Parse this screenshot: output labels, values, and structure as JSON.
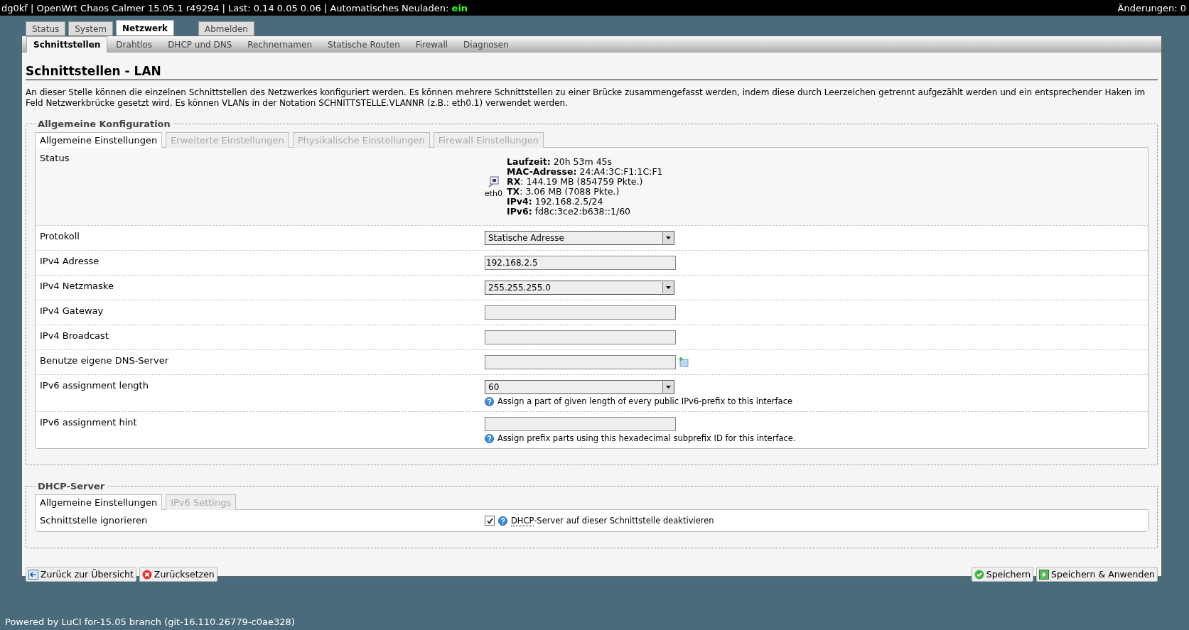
{
  "top_bar": {
    "status_line": "dg0kf | OpenWrt Chaos Calmer 15.05.1 r49294 | Last: 0.14 0.05 0.06 | Automatisches Neuladen:",
    "autoreload": "ein",
    "changes": "Änderungen: 0"
  },
  "main_tabs": [
    {
      "label": "Status",
      "selected": false,
      "kind": "menu"
    },
    {
      "label": "System",
      "selected": false,
      "kind": "menu"
    },
    {
      "label": "Netzwerk",
      "selected": true,
      "kind": "menu"
    },
    {
      "label": "Abmelden",
      "selected": false,
      "kind": "logout"
    }
  ],
  "sub_tabs": [
    {
      "label": "Schnittstellen",
      "selected": true
    },
    {
      "label": "Drahtlos",
      "selected": false
    },
    {
      "label": "DHCP und DNS",
      "selected": false
    },
    {
      "label": "Rechnernamen",
      "selected": false
    },
    {
      "label": "Statische Routen",
      "selected": false
    },
    {
      "label": "Firewall",
      "selected": false
    },
    {
      "label": "Diagnosen",
      "selected": false
    }
  ],
  "title": "Schnittstellen - LAN",
  "description": "An dieser Stelle können die einzelnen Schnittstellen des Netzwerkes konfiguriert werden. Es können mehrere Schnittstellen zu einer Brücke zusammengefasst werden, indem diese durch Leerzeichen getrennt aufgezählt werden und ein entsprechender Haken im Feld Netzwerkbrücke gesetzt wird. Es können VLANs in der Notation SCHNITTSTELLE.VLANNR (z.B.: eth0.1) verwendet werden.",
  "general_config": {
    "legend": "Allgemeine Konfiguration",
    "tabs": [
      {
        "label": "Allgemeine Einstellungen",
        "selected": true,
        "disabled": false
      },
      {
        "label": "Erweiterte Einstellungen",
        "selected": false,
        "disabled": true
      },
      {
        "label": "Physikalische Einstellungen",
        "selected": false,
        "disabled": true
      },
      {
        "label": "Firewall Einstellungen",
        "selected": false,
        "disabled": true
      }
    ],
    "status": {
      "label": "Status",
      "device": "eth0",
      "lines": [
        "**Laufzeit:** 20h 53m 45s",
        "**MAC-Adresse:** 24:A4:3C:F1:1C:F1",
        "**RX**: 144.19 MB (854759 Pkte.)",
        "**TX**: 3.06 MB (7088 Pkte.)",
        "**IPv4:** 192.168.2.5/24",
        "**IPv6:** fd8c:3ce2:b638::1/60"
      ]
    },
    "fields": [
      {
        "label": "Protokoll",
        "kind": "select",
        "value": "Statische Adresse"
      },
      {
        "label": "IPv4 Adresse",
        "kind": "text",
        "value": "192.168.2.5"
      },
      {
        "label": "IPv4 Netzmaske",
        "kind": "select",
        "value": "255.255.255.0"
      },
      {
        "label": "IPv4 Gateway",
        "kind": "text"
      },
      {
        "label": "IPv4 Broadcast",
        "kind": "text"
      },
      {
        "label": "Benutze eigene DNS-Server",
        "kind": "list"
      },
      {
        "label": "IPv6 assignment length",
        "kind": "select",
        "value": "60",
        "help": "Assign a part of given length of every public IPv6-prefix to this interface"
      },
      {
        "label": "IPv6 assignment hint",
        "kind": "text",
        "help": "Assign prefix parts using this hexadecimal subprefix ID for this interface."
      }
    ]
  },
  "dhcp_server": {
    "legend": "DHCP-Server",
    "tabs": [
      {
        "label": "Allgemeine Einstellungen",
        "selected": true,
        "disabled": false
      },
      {
        "label": "IPv6 Settings",
        "selected": false,
        "disabled": true
      }
    ],
    "row": {
      "label": "Schnittstelle ignorieren",
      "checked": true,
      "abbr": "DHCP",
      "help": "-Server auf dieser Schnittstelle deaktivieren"
    }
  },
  "buttons_left": [
    {
      "label": "Zurück zur Übersicht",
      "kind": "back"
    },
    {
      "label": "Zurücksetzen",
      "kind": "reset"
    }
  ],
  "buttons_right": [
    {
      "label": "Speichern",
      "kind": "save"
    },
    {
      "label": "Speichern & Anwenden",
      "kind": "apply"
    }
  ],
  "footer": "Powered by LuCI for-15.05 branch (git-16.110.26779-c0ae328)"
}
